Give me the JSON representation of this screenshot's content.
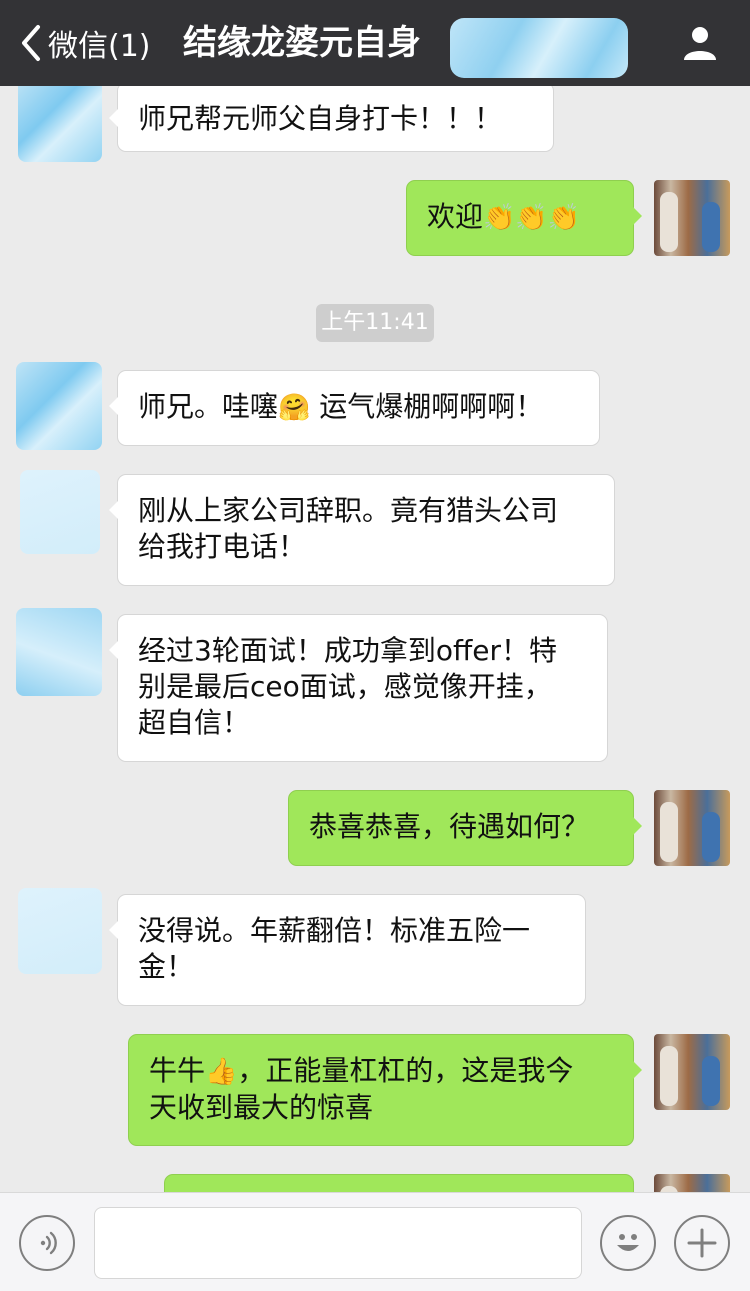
{
  "header": {
    "back_label": "微信(1)",
    "title": "结缘龙婆元自身"
  },
  "messages": [
    {
      "side": "in",
      "text": "师兄帮元师父自身打卡！！！"
    },
    {
      "side": "out",
      "text": "欢迎",
      "emoji": "👏👏👏"
    },
    {
      "type": "time",
      "text": "上午11:41"
    },
    {
      "side": "in",
      "text": "师兄。哇噻",
      "emoji": "🤗",
      "text_after": " 运气爆棚啊啊啊！"
    },
    {
      "side": "in",
      "lines": [
        "刚从上家公司辞职。竟有猎头公司",
        "给我打电话！"
      ]
    },
    {
      "side": "in",
      "lines": [
        "经过3轮面试！成功拿到offer！特",
        "别是最后ceo面试，感觉像开挂，",
        "超自信！"
      ]
    },
    {
      "side": "out",
      "text": "恭喜恭喜，待遇如何？"
    },
    {
      "side": "in",
      "lines": [
        "没得说。年薪翻倍！标准五险一",
        "金！"
      ]
    },
    {
      "side": "out",
      "text_before": "牛牛",
      "emoji": "👍",
      "lines": [
        "，正能量杠杠的，这是我今",
        "天收到最大的惊喜"
      ]
    }
  ],
  "colors": {
    "header_bg": "#333336",
    "chat_bg": "#ebebeb",
    "bubble_in": "#ffffff",
    "bubble_out": "#a0e75a",
    "time_pill": "#cecece"
  },
  "icons": {
    "back": "chevron-left-icon",
    "profile": "person-icon",
    "voice": "voice-icon",
    "emoji": "smiley-icon",
    "more": "plus-icon"
  }
}
